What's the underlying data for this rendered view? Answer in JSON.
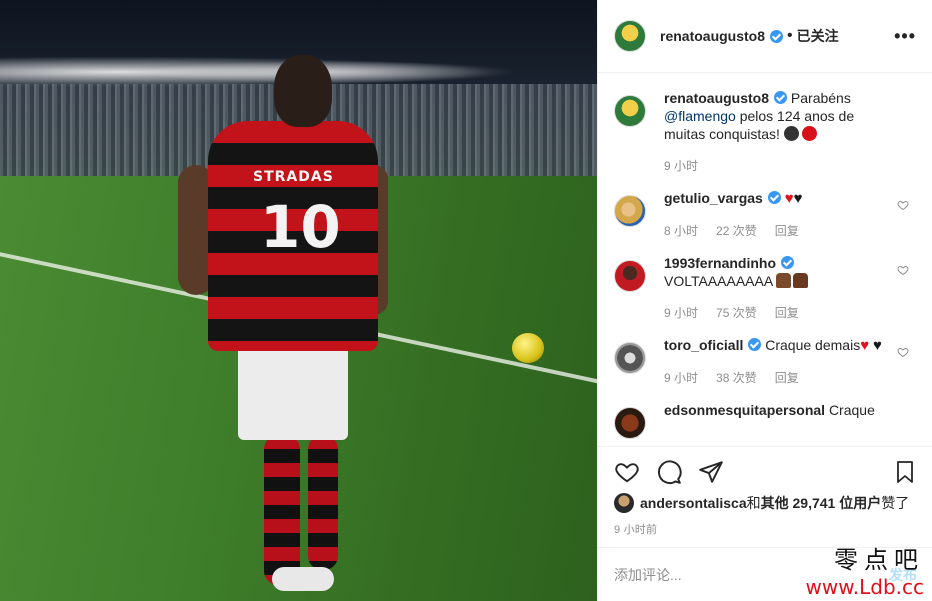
{
  "post": {
    "author": "renatoaugusto8",
    "follow_state": "已关注",
    "more_label": "•••"
  },
  "photo": {
    "jersey_name": "STRADAS",
    "jersey_number": "10"
  },
  "caption": {
    "user": "renatoaugusto8",
    "text_before": "Parabéns ",
    "mention": "@flamengo",
    "text_after": " pelos 124 anos de muitas conquistas!",
    "time": "9 小时"
  },
  "comments": [
    {
      "user": "getulio_vargas",
      "verified": true,
      "text": "",
      "emoji": [
        "red-heart",
        "black-heart"
      ],
      "time": "8 小时",
      "likes": "22 次赞",
      "reply": "回复"
    },
    {
      "user": "1993fernandinho",
      "verified": true,
      "text": "VOLTAAAAAAAA",
      "emoji": [
        "folded-hands",
        "raised-hands"
      ],
      "time": "9 小时",
      "likes": "75 次赞",
      "reply": "回复"
    },
    {
      "user": "toro_oficiall",
      "verified": true,
      "text": "Craque demais",
      "emoji": [
        "red-heart",
        "black-heart"
      ],
      "time": "9 小时",
      "likes": "38 次赞",
      "reply": "回复"
    },
    {
      "user": "edsonmesquitapersonal",
      "verified": false,
      "text": "Craque",
      "emoji": [],
      "time": "",
      "likes": "",
      "reply": ""
    }
  ],
  "likes": {
    "user": "andersontalisca",
    "conj": " 和 ",
    "others": "其他 29,741 位用户",
    "suffix": " 赞了"
  },
  "timestamp": "9 小时前",
  "add_comment": {
    "placeholder": "添加评论...",
    "post_label": "发布"
  },
  "watermark": {
    "line1": "零点吧",
    "line2": "www.Ldb.cc"
  },
  "colors": {
    "verified": "#3897f0",
    "heart": "#e0141e",
    "mention": "#00376b",
    "meta": "#8e8e8e"
  }
}
